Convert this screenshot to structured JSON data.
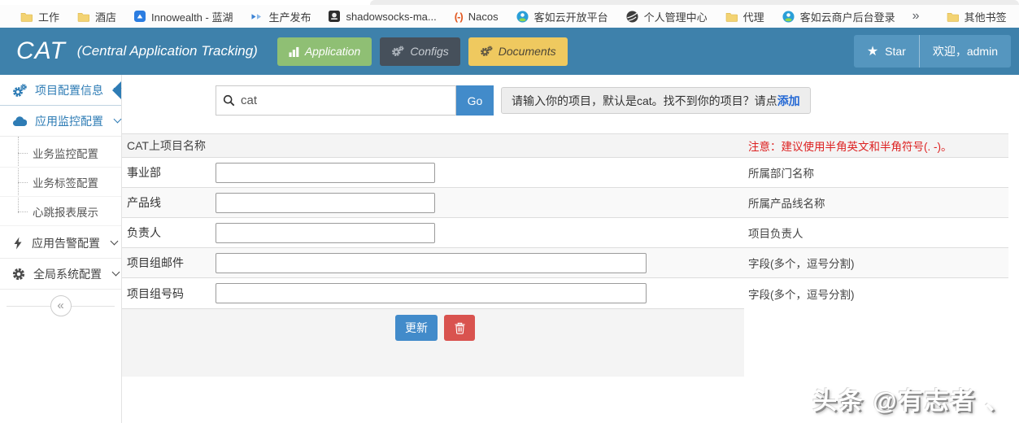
{
  "colors": {
    "header_blue": "#3e81ab",
    "header_box_blue": "#5596bf",
    "nav_application_green": "#8fbf74",
    "nav_configs_dark": "#46505b",
    "nav_documents_yellow": "#efc95f",
    "primary_button_blue": "#428bca",
    "danger_red": "#d9534f",
    "sidebar_active_blue": "#2e7cb5",
    "note_red": "#dd2222",
    "link_blue": "#2468d4"
  },
  "browser": {
    "bookmarks": [
      {
        "label": "工作",
        "icon": "folder-icon"
      },
      {
        "label": "酒店",
        "icon": "folder-icon"
      },
      {
        "label": "Innowealth - 蓝湖",
        "icon": "lanhu-icon"
      },
      {
        "label": "生产发布",
        "icon": "release-arrows-icon"
      },
      {
        "label": "shadowsocks-ma...",
        "icon": "shadowsocks-icon"
      },
      {
        "label": "Nacos",
        "icon": "nacos-icon"
      },
      {
        "label": "客如云开放平台",
        "icon": "person-badge-icon"
      },
      {
        "label": "个人管理中心",
        "icon": "globe-icon"
      },
      {
        "label": "代理",
        "icon": "folder-icon"
      },
      {
        "label": "客如云商户后台登录",
        "icon": "person-badge-icon"
      }
    ],
    "overflow_chevron": "»",
    "other_bookmarks": "其他书签"
  },
  "header": {
    "logo": "CAT",
    "subtitle": "(Central Application Tracking)",
    "nav": [
      {
        "label": "Application"
      },
      {
        "label": "Configs"
      },
      {
        "label": "Documents"
      }
    ],
    "star": "Star",
    "welcome": "欢迎，admin"
  },
  "sidebar": {
    "items": [
      {
        "label": "项目配置信息",
        "icon": "cogs-icon",
        "active": true
      },
      {
        "label": "应用监控配置",
        "icon": "cloud-icon",
        "expanded": true
      },
      {
        "label": "应用告警配置",
        "icon": "bolt-icon"
      },
      {
        "label": "全局系统配置",
        "icon": "gear-icon"
      }
    ],
    "subitems": [
      "业务监控配置",
      "业务标签配置",
      "心跳报表展示"
    ],
    "collapse": "«"
  },
  "search": {
    "value": "cat",
    "go": "Go",
    "hint": "请输入你的项目，默认是cat。找不到你的项目？请点",
    "hint_link": "添加"
  },
  "form": {
    "title": "CAT上项目名称",
    "note": "注意：建议使用半角英文和半角符号(. -)。",
    "rows": [
      {
        "label": "事业部",
        "desc": "所属部门名称",
        "wide": false
      },
      {
        "label": "产品线",
        "desc": "所属产品线名称",
        "wide": false
      },
      {
        "label": "负责人",
        "desc": "项目负责人",
        "wide": false
      },
      {
        "label": "项目组邮件",
        "desc": "字段(多个，逗号分割)",
        "wide": true
      },
      {
        "label": "项目组号码",
        "desc": "字段(多个，逗号分割)",
        "wide": true
      }
    ],
    "update": "更新"
  },
  "watermark": "头条 @有志者 、"
}
